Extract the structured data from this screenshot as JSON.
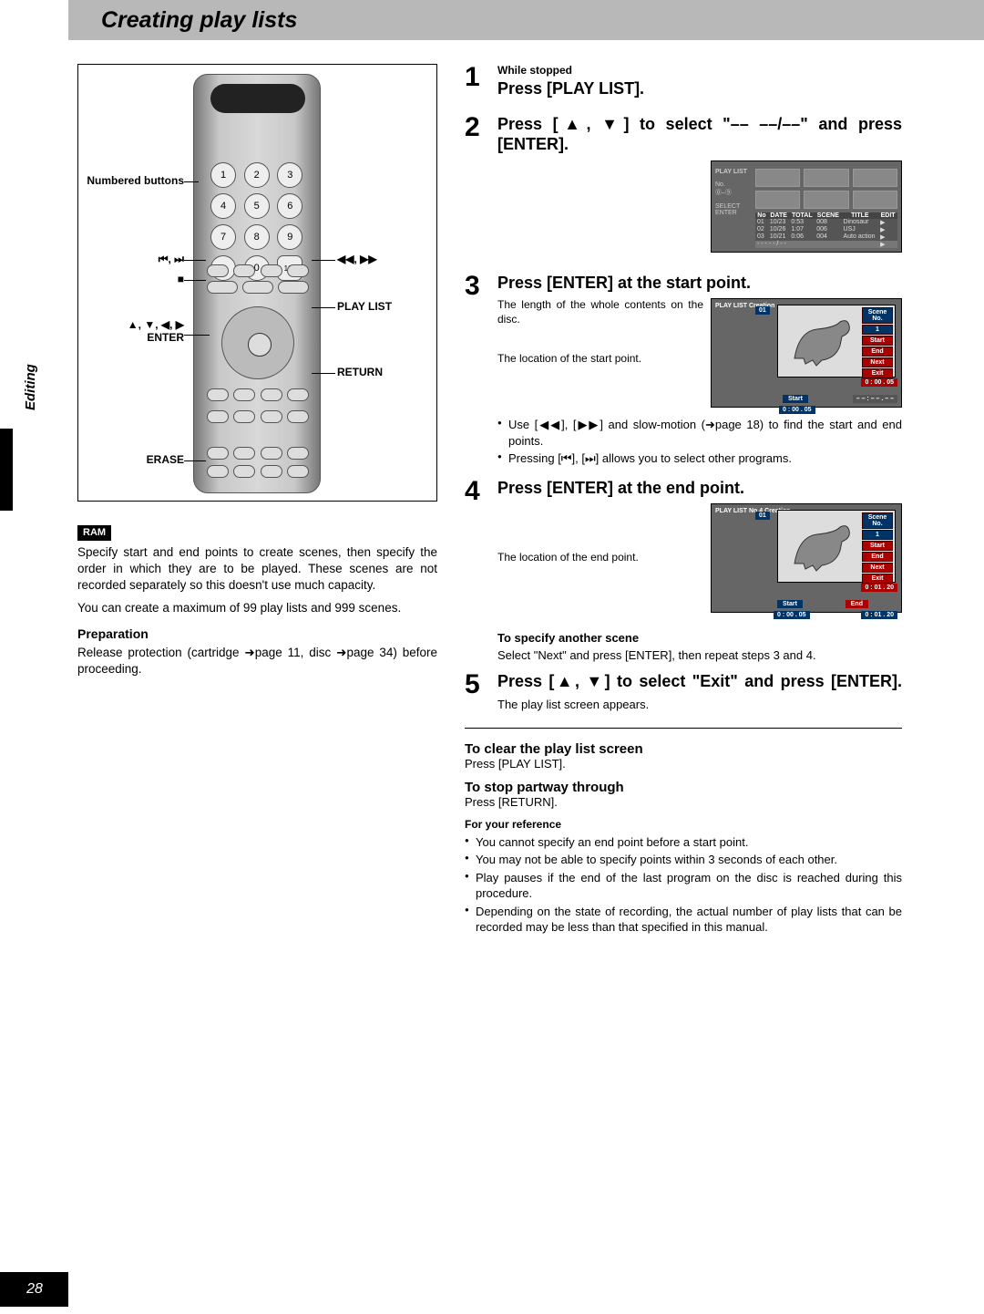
{
  "page_number": "28",
  "side_tab": "Editing",
  "title": "Creating play lists",
  "remote": {
    "numbered_label": "Numbered buttons",
    "play_list": "PLAY LIST",
    "enter": "ENTER",
    "arrows": "▲, ▼, ◀, ▶",
    "return": "RETURN",
    "erase": "ERASE",
    "skip": "⏮, ⏭",
    "seek": "◀◀, ▶▶",
    "stop": "■"
  },
  "ram": "RAM",
  "left_p1": "Specify start and end points to create scenes, then specify the order in which they are to be played. These scenes are not recorded separately so this doesn't use much capacity.",
  "left_p2": "You can create a maximum of 99 play lists and 999 scenes.",
  "prep_head": "Preparation",
  "prep_body": "Release protection (cartridge ➜page 11, disc ➜page 34) before proceeding.",
  "steps": {
    "s1_pre": "While stopped",
    "s1": "Press [PLAY LIST].",
    "s2": "Press [▲, ▼] to select \"–– ––/––\" and press [ENTER].",
    "s3": "Press [ENTER] at the start point.",
    "s3_cap1": "The length of the whole contents on the disc.",
    "s3_cap2": "The location of the start point.",
    "s3_b1": "Use [◀◀], [▶▶] and slow-motion (➜page 18) to find the start and end points.",
    "s3_b2": "Pressing [⏮], [⏭] allows you to select other programs.",
    "s4": "Press [ENTER] at the end point.",
    "s4_cap": "The location of the end point.",
    "s4_bold": "To specify another scene",
    "s4_after": "Select \"Next\" and press [ENTER], then repeat steps 3 and 4.",
    "s5": "Press [▲, ▼] to select \"Exit\" and press [ENTER].",
    "s5_after": "The play list screen appears."
  },
  "osd1": {
    "title": "PLAY LIST",
    "no": "No.",
    "sel": "SELECT",
    "enter": "ENTER",
    "headers": [
      "No",
      "DATE",
      "TOTAL",
      "SCENE",
      "TITLE",
      "EDIT"
    ],
    "rows": [
      [
        "01",
        "10/23",
        "0:53",
        "008",
        "Dinosaur",
        "▶"
      ],
      [
        "02",
        "10/26",
        "1:07",
        "006",
        "USJ",
        "▶"
      ],
      [
        "03",
        "10/21",
        "0:06",
        "004",
        "Auto action",
        "▶"
      ]
    ],
    "blank": "- - -  - - / - -"
  },
  "osd2": {
    "title": "PLAY LIST Creation",
    "scene_label": "Scene No.",
    "scene_no": "1",
    "num": "01",
    "start": "Start",
    "end": "End",
    "next": "Next",
    "exit": "Exit",
    "t_start": "0 : 00 . 05",
    "t_blank": "– – : – – . – –",
    "start_lab": "Start"
  },
  "osd3": {
    "title": "PLAY LIST No.4 Creation",
    "scene_no": "1",
    "num": "01",
    "t_start": "0 : 00 . 05",
    "t_end": "0 : 01 . 20",
    "end_lab": "End"
  },
  "after": {
    "clear_head": "To clear the play list screen",
    "clear_body": "Press [PLAY LIST].",
    "stop_head": "To stop partway through",
    "stop_body": "Press [RETURN].",
    "ref_head": "For your reference",
    "ref": [
      "You cannot specify an end point before a start point.",
      "You may not be able to specify points within 3 seconds of each other.",
      "Play pauses if the end of the last program on the disc is reached during this procedure.",
      "Depending on the state of recording, the actual number of play lists that can be recorded may be less than that specified in this manual."
    ]
  }
}
